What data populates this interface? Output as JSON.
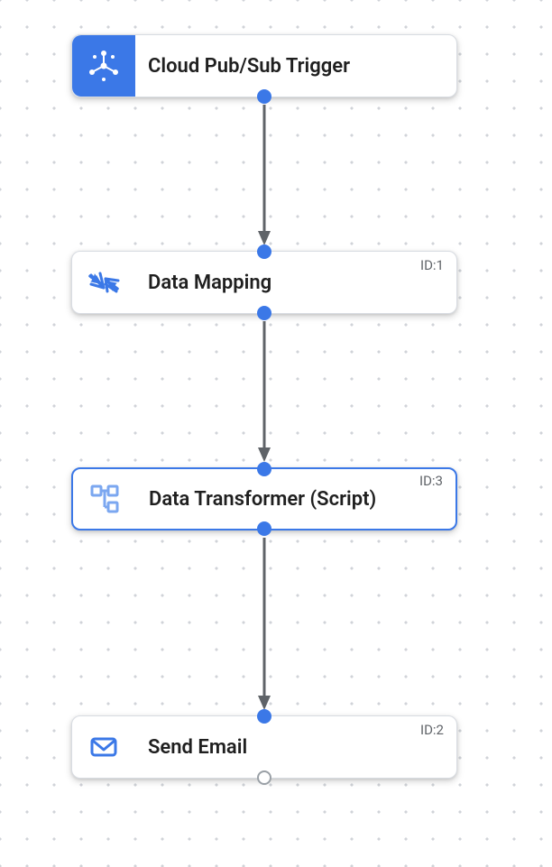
{
  "nodes": {
    "trigger": {
      "label": "Cloud Pub/Sub Trigger",
      "icon": "pubsub-icon",
      "id_label": ""
    },
    "mapping": {
      "label": "Data Mapping",
      "icon": "data-mapping-icon",
      "id_label": "ID:1"
    },
    "transformer": {
      "label": "Data Transformer (Script)",
      "icon": "data-transformer-icon",
      "id_label": "ID:3"
    },
    "email": {
      "label": "Send Email",
      "icon": "send-email-icon",
      "id_label": "ID:2"
    }
  },
  "colors": {
    "accent": "#3b78e7",
    "node_border": "#d8dce2",
    "text": "#1f1f1f",
    "id_text": "#5f6368"
  }
}
